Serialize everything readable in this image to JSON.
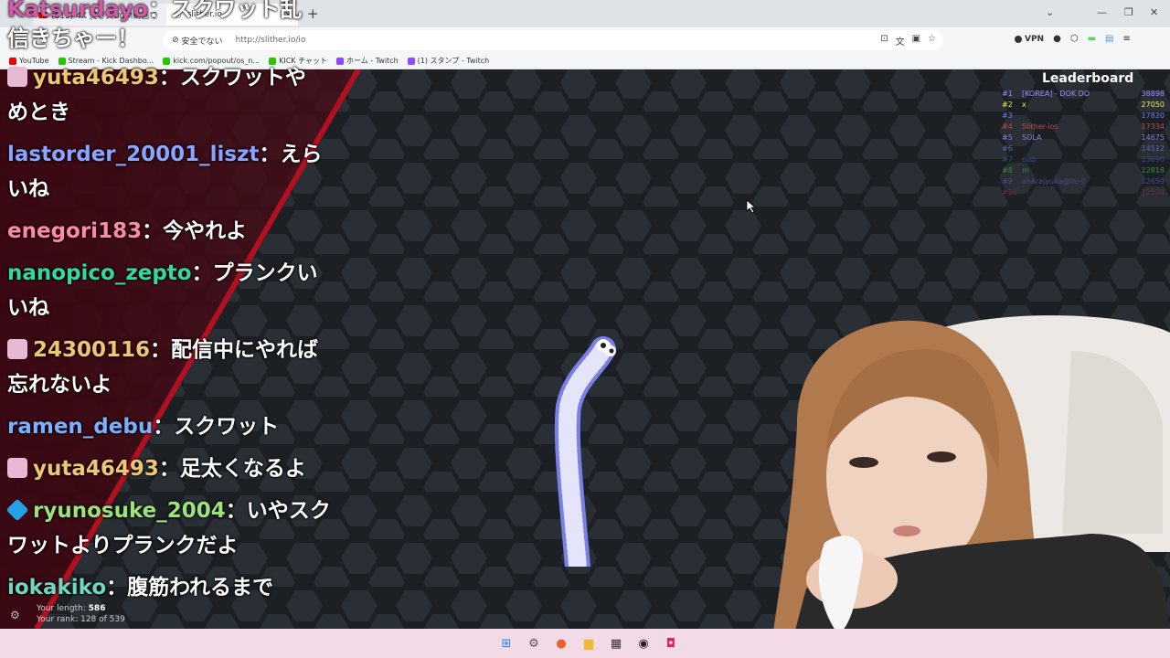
{
  "browser": {
    "tab_label": "(819) 4K 焚き火BGM動画で",
    "active_tab_label": "slither.io",
    "security_label": "安全でない",
    "url": "http://slither.io/io",
    "vpn_label": "VPN",
    "bookmarks": [
      {
        "label": "YouTube",
        "color": "#e00"
      },
      {
        "label": "Stream - Kick Dashbo...",
        "color": "#2ac400"
      },
      {
        "label": "kick.com/popout/os_n...",
        "color": "#2ac400"
      },
      {
        "label": "KICK チャット",
        "color": "#2ac400"
      },
      {
        "label": "ホーム - Twitch",
        "color": "#9146ff"
      },
      {
        "label": "(1) スタンプ - Twitch",
        "color": "#9146ff"
      }
    ]
  },
  "chat": {
    "top_overlay": {
      "user": "Katsurdayo",
      "text": "：スクワット乱",
      "line2": "信きちゃー！"
    },
    "messages": [
      {
        "user": "yuta46493",
        "color": "#f0c674",
        "text": "：スクワットや",
        "line2": "めとき",
        "badge": "#e7b9d4"
      },
      {
        "user": "lastorder_20001_liszt",
        "color": "#8aa4ff",
        "text": "：えら",
        "line2": "いね",
        "badge": ""
      },
      {
        "user": "enegori183",
        "color": "#ff8aa8",
        "text": "：今やれよ",
        "line2": "",
        "badge": ""
      },
      {
        "user": "nanopico_zepto",
        "color": "#33d9a0",
        "text": "：プランクい",
        "line2": "いね",
        "badge": ""
      },
      {
        "user": "24300116",
        "color": "#f0c674",
        "text": "：配信中にやれば",
        "line2": "忘れないよ",
        "badge": "#e7b9d4"
      },
      {
        "user": "ramen_debu",
        "color": "#7ab0ff",
        "text": "：スクワット",
        "line2": "",
        "badge": ""
      },
      {
        "user": "yuta46493",
        "color": "#f0c674",
        "text": "：足太くなるよ",
        "line2": "",
        "badge": "#e7b9d4"
      },
      {
        "user": "ryunosuke_2004",
        "color": "#9be37a",
        "text": "：いやスク",
        "line2": "ワットよりプランクだよ",
        "badge": "#22a0e8"
      },
      {
        "user": "iokakiko",
        "color": "#6fd8c0",
        "text": "：腹筋われるまで",
        "line2": "",
        "badge": ""
      }
    ]
  },
  "leaderboard": {
    "title": "Leaderboard",
    "rows": [
      {
        "rank": "#1",
        "name": "[KOREA] - DOK DO",
        "score": "38898",
        "color": "#9b8cff"
      },
      {
        "rank": "#2",
        "name": "x",
        "score": "27050",
        "color": "#e8f04a"
      },
      {
        "rank": "#3",
        "name": "",
        "score": "17820",
        "color": "#6a7cff"
      },
      {
        "rank": "#4",
        "name": "Slither-ios",
        "score": "17334",
        "color": "#c24a4a"
      },
      {
        "rank": "#5",
        "name": "SOLA",
        "score": "14675",
        "color": "#8a7be0"
      },
      {
        "rank": "#6",
        "name": "",
        "score": "14512",
        "color": "#5b6ab8"
      },
      {
        "rank": "#7",
        "name": "dub",
        "score": "13690",
        "color": "#3c4a8a"
      },
      {
        "rank": "#8",
        "name": "m",
        "score": "12818",
        "color": "#3a8a3a"
      },
      {
        "rank": "#9",
        "name": "aharajyuka@ilu-li",
        "score": "12659",
        "color": "#4a4a8a"
      },
      {
        "rank": "#10",
        "name": "",
        "score": "12524",
        "color": "#7a2a3a"
      }
    ]
  },
  "stats": {
    "length_label": "Your length:",
    "length_value": "586",
    "rank_text": "Your rank: 128 of 539"
  }
}
